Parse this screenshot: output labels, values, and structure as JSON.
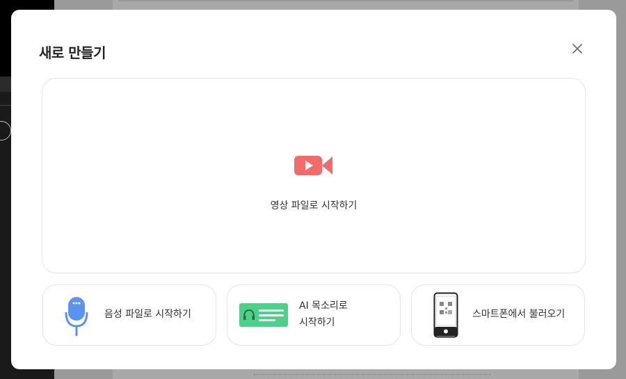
{
  "modal": {
    "title": "새로 만들기",
    "close_icon": "close-icon"
  },
  "options": {
    "video": {
      "label": "영상 파일로 시작하기",
      "icon": "video-camera-icon",
      "color": "#f26b6b"
    },
    "audio": {
      "label": "음성 파일로 시작하기",
      "icon": "microphone-icon",
      "color": "#5b93f0"
    },
    "ai_voice": {
      "label_line1": "AI 목소리로",
      "label_line2": "시작하기",
      "icon": "headphone-script-icon",
      "color": "#4fd08a"
    },
    "smartphone": {
      "label": "스마트폰에서 불러오기",
      "icon": "smartphone-qr-icon",
      "color": "#222222"
    }
  }
}
